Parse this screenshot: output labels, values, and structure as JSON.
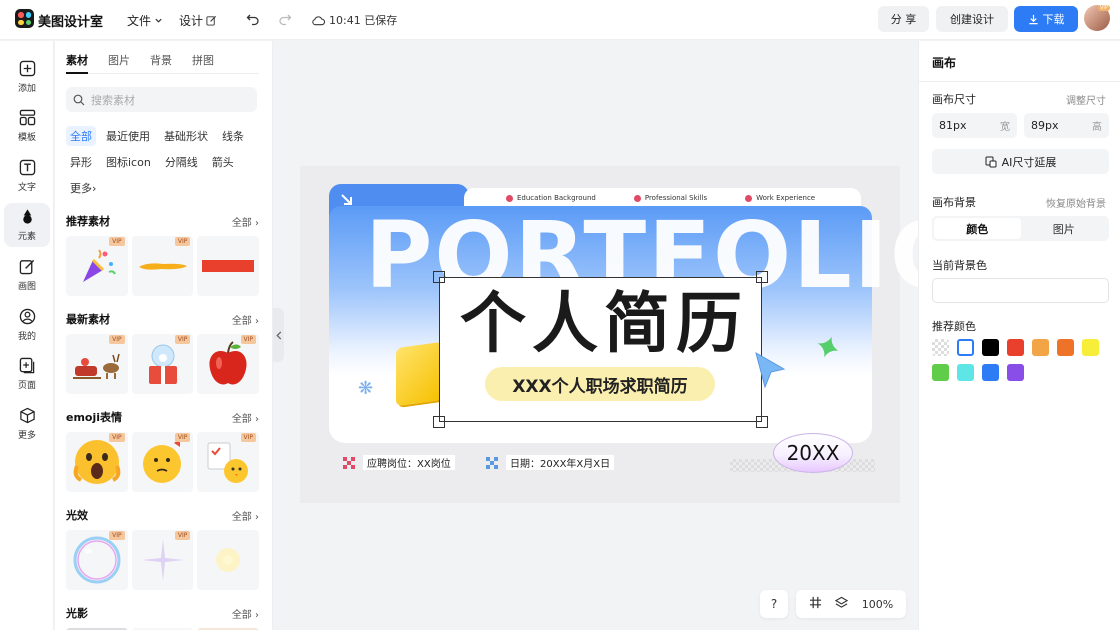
{
  "app": {
    "name": "美图设计室"
  },
  "header": {
    "menu_file": "文件",
    "menu_design": "设计",
    "saved_status": "10:41 已保存",
    "share_label": "分 享",
    "create_label": "创建设计",
    "download_label": "下载",
    "vip_label": "VIP"
  },
  "leftbar": {
    "items": [
      {
        "label": "添加",
        "icon": "plus-square-icon"
      },
      {
        "label": "模板",
        "icon": "layout-icon"
      },
      {
        "label": "文字",
        "icon": "text-icon"
      },
      {
        "label": "元素",
        "icon": "shapes-icon"
      },
      {
        "label": "画图",
        "icon": "pen-icon"
      },
      {
        "label": "我的",
        "icon": "user-icon"
      },
      {
        "label": "页面",
        "icon": "page-add-icon"
      },
      {
        "label": "更多",
        "icon": "cube-icon"
      }
    ]
  },
  "panel": {
    "tabs": [
      "素材",
      "图片",
      "背景",
      "拼图"
    ],
    "search_placeholder": "搜索素材",
    "chips": [
      "全部",
      "最近使用",
      "基础形状",
      "线条",
      "异形",
      "图标icon",
      "分隔线",
      "箭头",
      "更多"
    ],
    "all_label": "全部",
    "vip_label": "VIP",
    "sections": [
      {
        "title": "推荐素材"
      },
      {
        "title": "最新素材"
      },
      {
        "title": "emoji表情"
      },
      {
        "title": "光效"
      },
      {
        "title": "光影"
      }
    ]
  },
  "canvas": {
    "strip_items": [
      "Education Background",
      "Professional Skills",
      "Work Experience"
    ],
    "portfolio_text": "PORTFOLIO",
    "title": "个人简历",
    "subtitle": "XXX个人职场求职简历",
    "position_text": "应聘岗位：XX岗位",
    "date_text": "日期：20XX年X月X日",
    "year_badge": "20XX"
  },
  "zoom": {
    "help": "?",
    "level": "100%"
  },
  "right_panel": {
    "title": "画布",
    "size_label": "画布尺寸",
    "adjust_label": "调整尺寸",
    "width_value": "81px",
    "width_unit": "宽",
    "height_value": "89px",
    "height_unit": "高",
    "ai_button": "AI尺寸延展",
    "bg_label": "画布背景",
    "restore_label": "恢复原始背景",
    "seg_color": "颜色",
    "seg_image": "图片",
    "current_bg_label": "当前背景色",
    "recommend_label": "推荐颜色",
    "swatches": [
      "transparent",
      "#ffffff",
      "#000000",
      "#e8402d",
      "#f3a447",
      "#ee7329",
      "#f7ee3a",
      "#5fcc4a",
      "#5ee6e6",
      "#2d7cf6",
      "#8a4ee8"
    ]
  }
}
